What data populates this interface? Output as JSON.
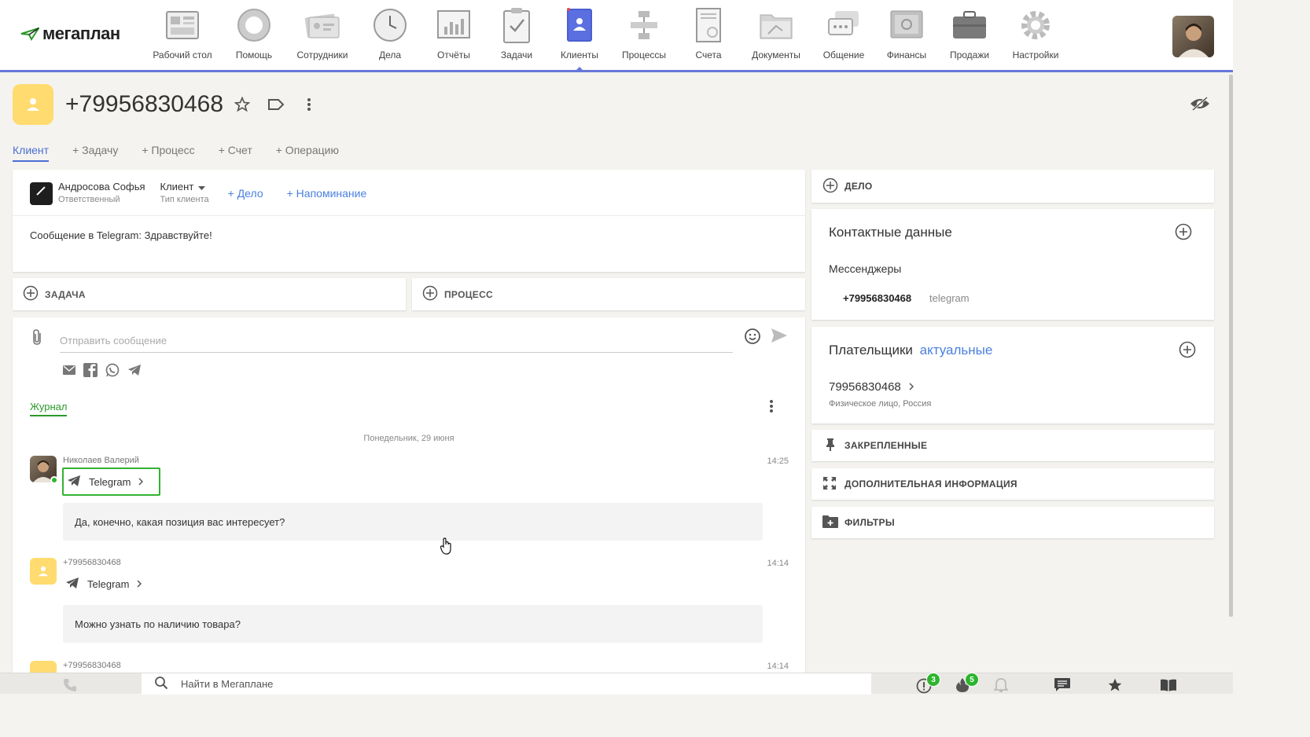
{
  "app": {
    "logo_text": "мегаплан"
  },
  "nav": [
    {
      "label": "Рабочий стол",
      "icon": "desktop-icon"
    },
    {
      "label": "Помощь",
      "icon": "lifebuoy-icon"
    },
    {
      "label": "Сотрудники",
      "icon": "employees-icon"
    },
    {
      "label": "Дела",
      "icon": "clock-icon"
    },
    {
      "label": "Отчёты",
      "icon": "reports-icon"
    },
    {
      "label": "Задачи",
      "icon": "tasks-icon"
    },
    {
      "label": "Клиенты",
      "icon": "clients-icon",
      "active": true
    },
    {
      "label": "Процессы",
      "icon": "processes-icon"
    },
    {
      "label": "Счета",
      "icon": "invoices-icon"
    },
    {
      "label": "Документы",
      "icon": "documents-icon"
    },
    {
      "label": "Общение",
      "icon": "chat-icon"
    },
    {
      "label": "Финансы",
      "icon": "safe-icon"
    },
    {
      "label": "Продажи",
      "icon": "briefcase-icon"
    },
    {
      "label": "Настройки",
      "icon": "gear-icon"
    }
  ],
  "client": {
    "title": "+79956830468"
  },
  "tabs": [
    "Клиент",
    "+ Задачу",
    "+ Процесс",
    "+ Счет",
    "+ Операцию"
  ],
  "info": {
    "responsible_name": "Андросова Софья",
    "responsible_label": "Ответственный",
    "client_type": "Клиент",
    "client_type_label": "Тип клиента",
    "add_deal": "+ Дело",
    "add_reminder": "+ Напоминание",
    "message": "Сообщение в Telegram: Здравствуйте!"
  },
  "actions": {
    "task": "ЗАДАЧА",
    "process": "ПРОЦЕСС"
  },
  "chat": {
    "placeholder": "Отправить сообщение",
    "journal_tab": "Журнал",
    "date_separator": "Понедельник, 29 июня",
    "entries": [
      {
        "author": "Николаев Валерий",
        "time": "14:25",
        "channel": "Telegram",
        "text": "Да, конечно, какая позиция вас интересует?"
      },
      {
        "author": "+79956830468",
        "time": "14:14",
        "channel": "Telegram",
        "text": "Можно узнать по наличию товара?"
      },
      {
        "author": "+79956830468",
        "time": "14:14"
      }
    ]
  },
  "right": {
    "deal": "ДЕЛО",
    "contacts_title": "Контактные данные",
    "messengers_label": "Мессенджеры",
    "phone": "+79956830468",
    "messenger": "telegram",
    "payers_title": "Плательщики",
    "payers_filter": "актуальные",
    "payer_number": "79956830468",
    "payer_desc": "Физическое лицо, Россия",
    "pinned": "ЗАКРЕПЛЕННЫЕ",
    "additional_info": "ДОПОЛНИТЕЛЬНАЯ ИНФОРМАЦИЯ",
    "filters": "ФИЛЬТРЫ"
  },
  "footer": {
    "search_placeholder": "Найти в Мегаплане",
    "badge_alerts": "3",
    "badge_hot": "5"
  },
  "colors": {
    "accent": "#6677d8",
    "link": "#4a80e0",
    "green": "#2db52d",
    "client_avatar": "#ffdb70"
  }
}
